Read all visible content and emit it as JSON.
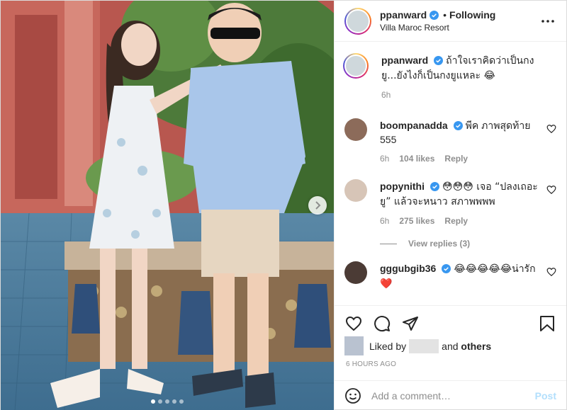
{
  "post": {
    "author": "ppanward",
    "follow_status": "Following",
    "location": "Villa Maroc Resort",
    "caption": "ถ้าใจเราคิดว่าเป็นกงยู...ยังไงก็เป็นกงยูแหละ 😂",
    "caption_time": "6h",
    "timestamp": "6 HOURS AGO",
    "carousel": {
      "count": 5,
      "active_index": 0
    }
  },
  "comments": [
    {
      "username": "boompanadda",
      "text": "พีค ภาพสุดท้าย 555",
      "time": "6h",
      "likes": "104 likes",
      "reply": "Reply"
    },
    {
      "username": "popynithi",
      "text": "😳😳😳 เจอ “ปลงเถอะยู” แล้วจะหนาว สภาพพพพ",
      "time": "6h",
      "likes": "275 likes",
      "reply": "Reply"
    },
    {
      "username": "gggubgib36",
      "text": "😂😂😂😂😂น่ารัก❤️"
    }
  ],
  "view_replies": "View replies (3)",
  "likes_summary": {
    "prefix": "Liked by",
    "connector": "and",
    "others": "others"
  },
  "add_comment": {
    "placeholder": "Add a comment…",
    "post_label": "Post"
  },
  "icons": {
    "more": "more-horizontal-icon",
    "verified": "verified-badge-icon",
    "like": "heart-outline-icon",
    "comment": "comment-bubble-icon",
    "share": "paper-plane-icon",
    "save": "bookmark-icon",
    "emoji": "smiley-icon",
    "next": "chevron-right-icon"
  },
  "colors": {
    "verified_blue": "#3897f0",
    "text_primary": "#262626",
    "text_secondary": "#8e8e8e",
    "post_button_disabled": "#b2dffc",
    "heart_red": "#e0245e"
  }
}
